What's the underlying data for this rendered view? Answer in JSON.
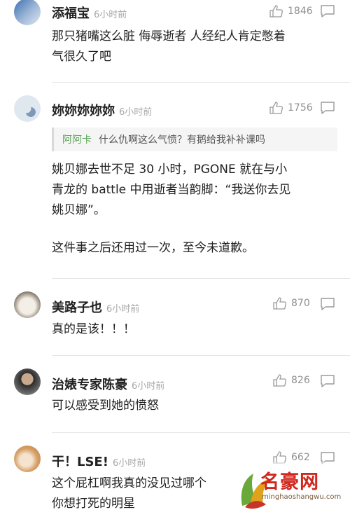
{
  "comments": [
    {
      "username": "添福宝",
      "time": "6小时前",
      "likes": "1846",
      "lines": [
        "那只猪嘴这么脏 侮辱逝者 人经纪人肯定憋着",
        "气很久了吧"
      ]
    },
    {
      "username": "妳妳妳妳妳",
      "time": "6小时前",
      "likes": "1756",
      "quote": {
        "user": "阿阿卡",
        "text": "什么仇啊这么气愤？有鹅给我补补课吗"
      },
      "paragraphs": [
        [
          "姚贝娜去世不足 30 小时，PGONE 就在与小",
          "青龙的 battle 中用逝者当韵脚：“我送你去见",
          "姚贝娜”。"
        ],
        [
          "这件事之后还用过一次，至今未道歉。"
        ]
      ]
    },
    {
      "username": "美路子也",
      "time": "6小时前",
      "likes": "870",
      "lines": [
        "真的是该！！！"
      ]
    },
    {
      "username": "治婊专家陈豪",
      "time": "6小时前",
      "likes": "826",
      "lines": [
        "可以感受到她的愤怒"
      ]
    },
    {
      "username": "干！LSE!",
      "time": "6小时前",
      "likes": "662",
      "lines": [
        "这个屁杠啊我真的没见过哪个",
        "你想打死的明星"
      ]
    }
  ],
  "watermark": {
    "brand": "名豪网",
    "url": "minghaoshangwu.com"
  },
  "icons": {
    "like": "thumbs-up-icon",
    "reply": "comment-bubble-icon"
  },
  "colors": {
    "quote_user": "#5fa55a",
    "watermark": "#d0271e"
  }
}
